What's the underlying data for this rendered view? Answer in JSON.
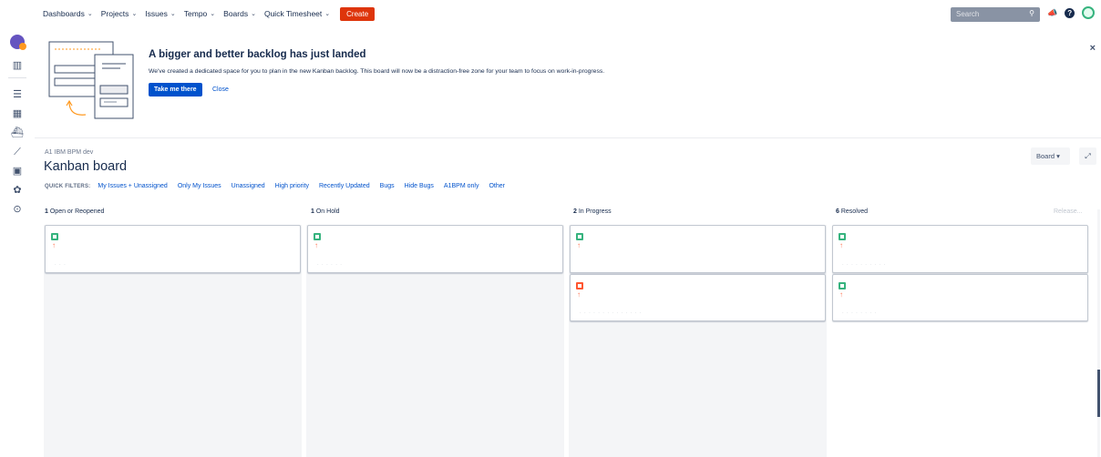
{
  "topnav": {
    "items": [
      {
        "label": "Dashboards"
      },
      {
        "label": "Projects"
      },
      {
        "label": "Issues"
      },
      {
        "label": "Tempo"
      },
      {
        "label": "Boards"
      },
      {
        "label": "Quick Timesheet"
      }
    ],
    "create_label": "Create",
    "search_placeholder": "Search"
  },
  "banner": {
    "title": "A bigger and better backlog has just landed",
    "text": "We've created a dedicated space for you to plan in the new Kanban backlog. This board will now be a distraction-free zone for your team to focus on work-in-progress.",
    "primary_button": "Take me there",
    "close_link": "Close"
  },
  "board": {
    "breadcrumb": "A1 IBM BPM dev",
    "title": "Kanban board",
    "board_button": "Board",
    "quick_filters_label": "QUICK FILTERS:",
    "quick_filters": [
      "My Issues + Unassigned",
      "Only My Issues",
      "Unassigned",
      "High priority",
      "Recently Updated",
      "Bugs",
      "Hide Bugs",
      "A1BPM only",
      "Other"
    ],
    "release_label": "Release...",
    "columns": [
      {
        "count": "1",
        "name": "Open or Reopened"
      },
      {
        "count": "1",
        "name": "On Hold"
      },
      {
        "count": "2",
        "name": "In Progress"
      },
      {
        "count": "6",
        "name": "Resolved"
      }
    ]
  },
  "colors": {
    "accent": "#0052cc",
    "create": "#de350b",
    "story": "#36b37e",
    "bug": "#ff5630",
    "priority_high": "#ff7452"
  }
}
